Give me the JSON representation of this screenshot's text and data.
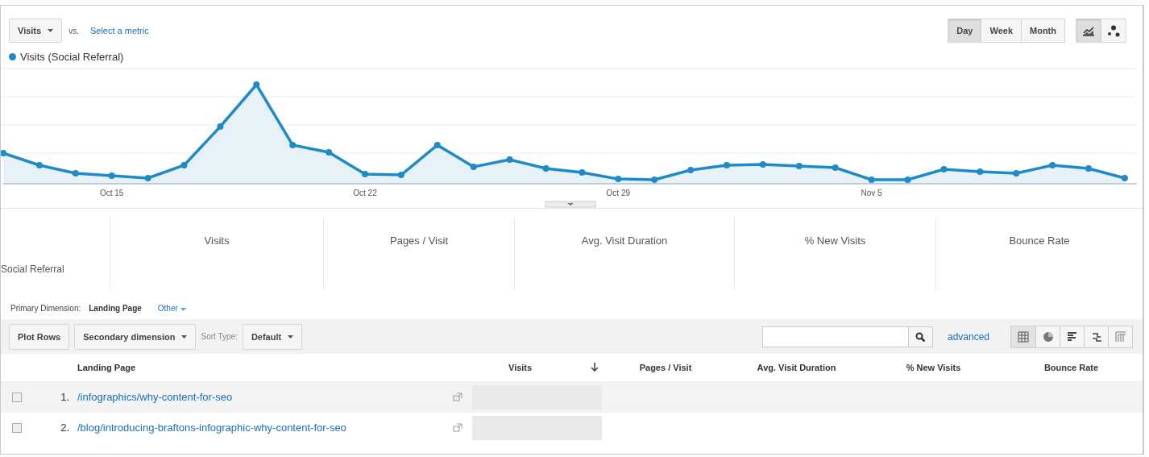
{
  "metric_selector": {
    "value": "Visits",
    "vs_label": "vs.",
    "compare_link": "Select a metric"
  },
  "period_buttons": [
    {
      "label": "Day",
      "selected": true
    },
    {
      "label": "Week",
      "selected": false
    },
    {
      "label": "Month",
      "selected": false
    }
  ],
  "chart_type_buttons": [
    {
      "kind": "line",
      "selected": true
    },
    {
      "kind": "motion",
      "selected": false
    }
  ],
  "legend": {
    "label": "Visits (Social Referral)",
    "color": "#1f8ac8"
  },
  "chart": {
    "x_labels": [
      "Oct 15",
      "Oct 22",
      "Oct 29",
      "Nov 5"
    ]
  },
  "summary": {
    "segment": "Social Referral",
    "columns": [
      "Visits",
      "Pages / Visit",
      "Avg. Visit Duration",
      "% New Visits",
      "Bounce Rate"
    ]
  },
  "dimension_bar": {
    "label": "Primary Dimension:",
    "value": "Landing Page",
    "other": "Other"
  },
  "toolbar": {
    "plot_rows": "Plot Rows",
    "secondary": "Secondary dimension",
    "sort_label": "Sort Type:",
    "sort_value": "Default",
    "advanced": "advanced",
    "views": [
      {
        "kind": "table",
        "selected": true
      },
      {
        "kind": "pie",
        "selected": false
      },
      {
        "kind": "bars",
        "selected": false
      },
      {
        "kind": "comparison",
        "selected": false
      },
      {
        "kind": "pivot",
        "selected": false
      }
    ]
  },
  "table": {
    "columns": [
      "Landing Page",
      "Visits",
      "Pages / Visit",
      "Avg. Visit Duration",
      "% New Visits",
      "Bounce Rate"
    ],
    "rows": [
      {
        "index": "1.",
        "page": "/infographics/why-content-for-seo",
        "checked": false,
        "highlighted": true
      },
      {
        "index": "2.",
        "page": "/blog/introducing-braftons-infographic-why-content-for-seo",
        "checked": false,
        "highlighted": false
      }
    ]
  }
}
